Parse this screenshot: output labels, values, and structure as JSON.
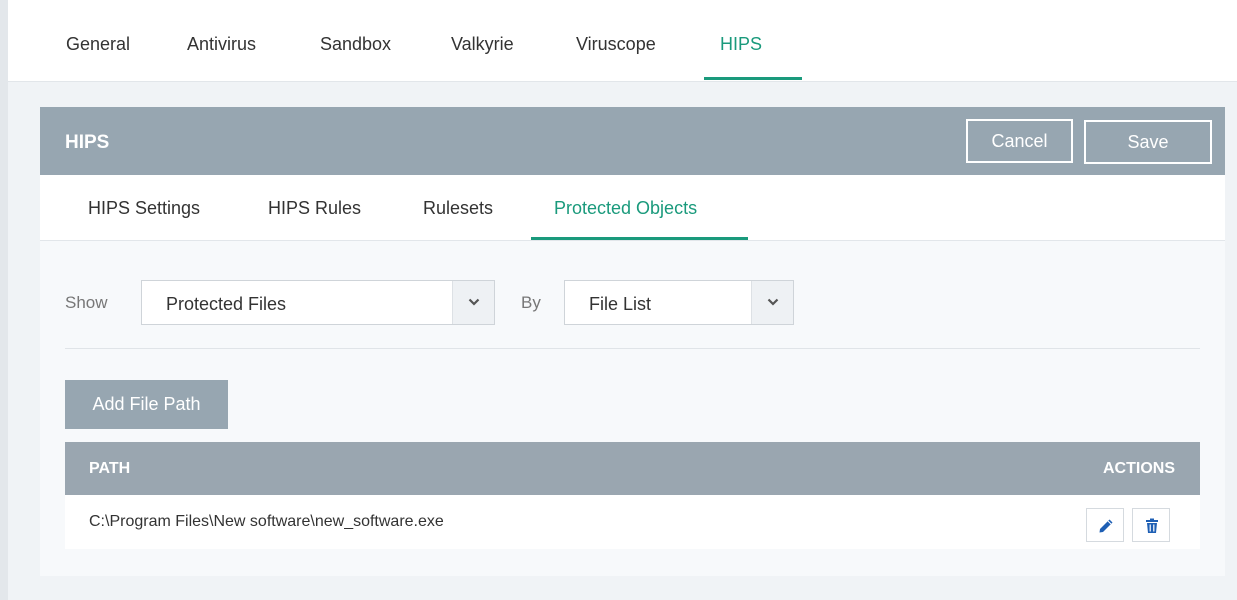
{
  "top_tabs": [
    {
      "label": "General"
    },
    {
      "label": "Antivirus"
    },
    {
      "label": "Sandbox"
    },
    {
      "label": "Valkyrie"
    },
    {
      "label": "Viruscope"
    },
    {
      "label": "HIPS",
      "active": true
    }
  ],
  "panel": {
    "title": "HIPS",
    "cancel_label": "Cancel",
    "save_label": "Save"
  },
  "sub_tabs": [
    {
      "label": "HIPS Settings"
    },
    {
      "label": "HIPS Rules"
    },
    {
      "label": "Rulesets"
    },
    {
      "label": "Protected Objects",
      "active": true
    }
  ],
  "filter": {
    "show_label": "Show",
    "show_value": "Protected Files",
    "by_label": "By",
    "by_value": "File List"
  },
  "add_button_label": "Add File Path",
  "table": {
    "columns": [
      "PATH",
      "ACTIONS"
    ],
    "rows": [
      {
        "path": "C:\\Program Files\\New software\\new_software.exe"
      }
    ]
  },
  "colors": {
    "accent": "#1a9a7c",
    "header_bg": "#97a6b1",
    "icon_blue": "#1e5fb4"
  },
  "icons": [
    "chevron-down-icon",
    "pencil-icon",
    "trash-icon"
  ]
}
